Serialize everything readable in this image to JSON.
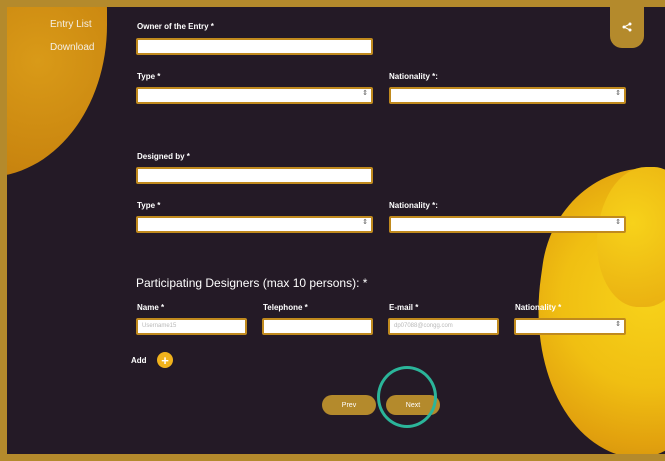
{
  "nav": {
    "entry_list": "Entry List",
    "download": "Download"
  },
  "owner": {
    "label": "Owner of the Entry *",
    "type_label": "Type *",
    "nationality_label": "Nationality *:"
  },
  "designer": {
    "label": "Designed by *",
    "type_label": "Type *",
    "nationality_label": "Nationality *:"
  },
  "participating": {
    "title": "Participating Designers (max 10 persons): *",
    "col_name": "Name *",
    "col_telephone": "Telephone *",
    "col_email": "E-mail *",
    "col_nationality": "Nationality *",
    "name_value": "Username15",
    "email_value": "dp07088@congg.com"
  },
  "actions": {
    "add_label": "Add",
    "add_icon": "+",
    "prev": "Prev",
    "next": "Next"
  },
  "icons": {
    "share": "share-icon",
    "select_arrow": "⇕"
  },
  "colors": {
    "background": "#241a26",
    "accent": "#b48a2c",
    "highlight_ring": "#2bb59a",
    "add_button": "#f0b21c"
  }
}
